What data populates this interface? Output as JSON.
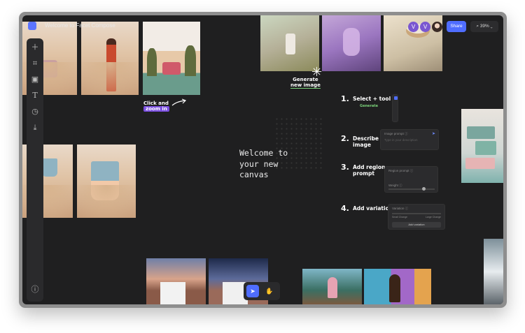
{
  "app": {
    "title": "Welcome to Facet Compose"
  },
  "header": {
    "avatars": [
      "V",
      "V"
    ],
    "share_label": "Share",
    "zoom_label": "39% ⌄"
  },
  "sidebar": {
    "icons": [
      "plus-icon",
      "frame-icon",
      "image-icon",
      "text-icon",
      "history-icon",
      "download-icon"
    ],
    "help_icon": "help-icon"
  },
  "canvas": {
    "welcome_text": "Welcome to\nyour new\ncanvas",
    "click_and": "Click and",
    "zoom_in": "zoom in",
    "generate_line1": "Generate",
    "generate_line2": "new image"
  },
  "steps": [
    {
      "num": "1.",
      "title": "Select + tool",
      "sub": "Generate"
    },
    {
      "num": "2.",
      "title": "Describe\nimage"
    },
    {
      "num": "3.",
      "title": "Add region\nprompt"
    },
    {
      "num": "4.",
      "title": "Add variation"
    }
  ],
  "panels": {
    "describe_label": "Image prompt ⓘ",
    "describe_placeholder": "Type in your description",
    "region_label": "Region prompt ⓘ",
    "region_weight": "Weight ⓘ",
    "variation_label": "Variation ⓘ",
    "variation_left": "Small Change",
    "variation_right": "Large Change",
    "variation_button": "Add variation"
  },
  "bottom_toolbar": {
    "select_icon": "cursor-icon",
    "hand_icon": "hand-icon"
  },
  "colors": {
    "accent": "#4f6dff",
    "purple": "#7b4fe0",
    "canvas": "#1f1f20"
  }
}
